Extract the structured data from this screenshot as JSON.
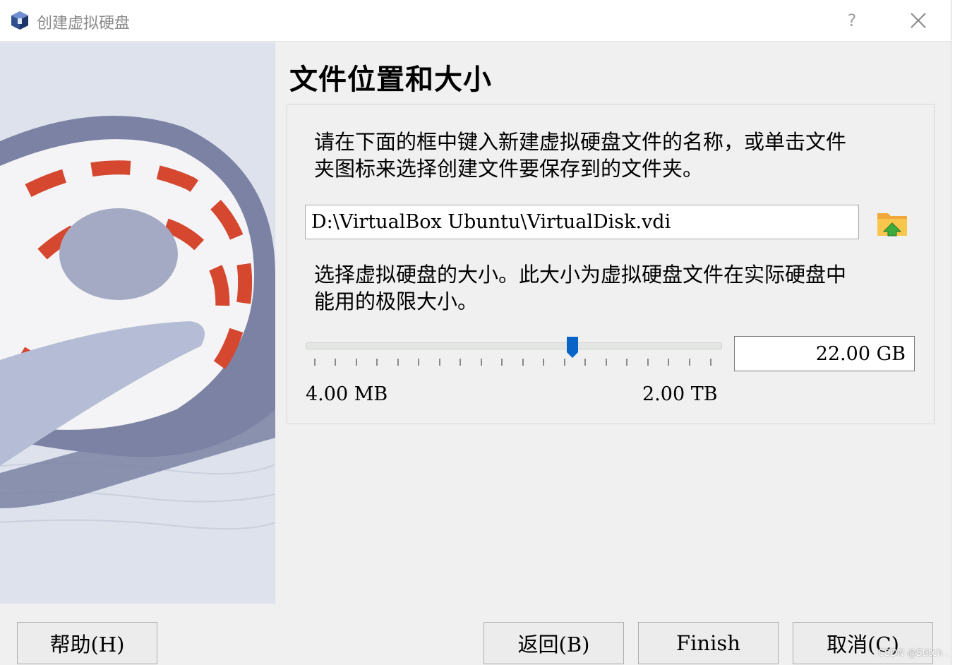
{
  "window": {
    "title": "创建虚拟硬盘",
    "help_symbol": "?",
    "close_icon": "close-icon",
    "app_icon": "virtualbox-cube-icon"
  },
  "page": {
    "title": "文件位置和大小",
    "location_desc_1": "请在下面的框中键入新建虚拟硬盘文件的名称，或单击文件",
    "location_desc_2": "夹图标来选择创建文件要保存到的文件夹。",
    "file_path": "D:\\VirtualBox Ubuntu\\VirtualDisk.vdi",
    "folder_icon": "folder-up-icon",
    "size_desc_1": "选择虚拟硬盘的大小。此大小为虚拟硬盘文件在实际硬盘中",
    "size_desc_2": "能用的极限大小。",
    "size_value": "22.00 GB",
    "min_label": "4.00 MB",
    "max_label": "2.00 TB"
  },
  "buttons": {
    "help": "帮助(H)",
    "back": "返回(B)",
    "finish": "Finish",
    "cancel": "取消(C)"
  },
  "watermark": "CSDN @Stitch .",
  "colors": {
    "accent": "#0a64c8",
    "disk_stripe": "#d5472f",
    "disk_ring": "#7b82a4"
  }
}
